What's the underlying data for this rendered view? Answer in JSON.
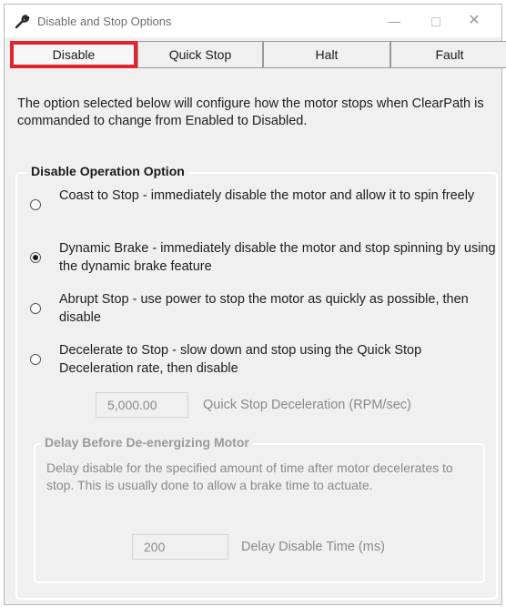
{
  "window": {
    "title": "Disable and Stop Options",
    "icon": "wrench-icon",
    "minimize_glyph": "—",
    "close_glyph": "✕"
  },
  "tabs": [
    {
      "label": "Disable",
      "selected": true
    },
    {
      "label": "Quick Stop",
      "selected": false
    },
    {
      "label": "Halt",
      "selected": false
    },
    {
      "label": "Fault",
      "selected": false
    }
  ],
  "intro": "The option selected below will configure how the motor stops when ClearPath is commanded to change from Enabled to Disabled.",
  "group": {
    "legend": "Disable Operation Option",
    "options": [
      {
        "label": "Coast to Stop - immediately disable the motor and allow it to spin freely",
        "checked": false
      },
      {
        "label": "Dynamic Brake - immediately disable the motor and stop spinning by using the dynamic brake feature",
        "checked": true
      },
      {
        "label": "Abrupt Stop - use power to stop the motor as quickly as possible, then disable",
        "checked": false
      },
      {
        "label": "Decelerate to Stop - slow down and stop using the Quick Stop Deceleration rate, then disable",
        "checked": false
      }
    ],
    "decel_value": "5,000.00",
    "decel_label": "Quick Stop Deceleration (RPM/sec)"
  },
  "delay": {
    "legend": "Delay Before De-energizing Motor",
    "description": "Delay disable for the specified amount of time after motor decelerates to stop. This is usually done to allow a brake time to actuate.",
    "value": "200",
    "label": "Delay Disable Time (ms)"
  },
  "colors": {
    "highlight_border": "#e3232f",
    "window_bg": "#f0f0f0",
    "disabled_text": "#8a8a8a"
  }
}
